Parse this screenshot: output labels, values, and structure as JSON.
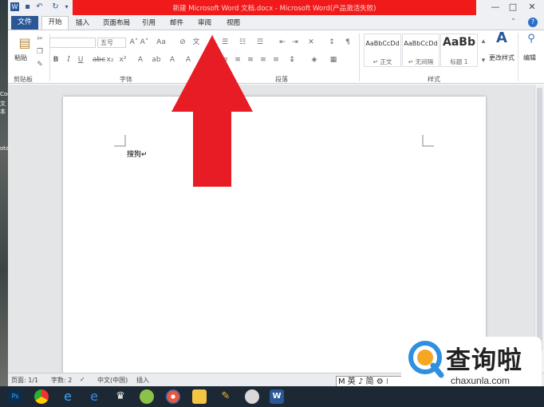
{
  "window": {
    "title": "新建 Microsoft Word 文档.docx - Microsoft Word(产品激活失败)",
    "app_icon": "word-app-icon",
    "controls": [
      "—",
      "□",
      "✕"
    ]
  },
  "desktop": {
    "labels": [
      "Cor",
      "文",
      "本",
      "ota"
    ]
  },
  "tabs": {
    "file": "文件",
    "items": [
      "开始",
      "插入",
      "页面布局",
      "引用",
      "邮件",
      "审阅",
      "视图"
    ]
  },
  "ribbon": {
    "clipboard": {
      "paste": "粘贴",
      "label": "剪贴板"
    },
    "font": {
      "size": "五号",
      "label": "字体"
    },
    "paragraph": {
      "label": "段落"
    },
    "styles": {
      "label": "样式",
      "items": [
        {
          "sample": "AaBbCcDd",
          "name": "↵ 正文"
        },
        {
          "sample": "AaBbCcDd",
          "name": "↵ 无间隔"
        },
        {
          "sample": "AaBb",
          "name": "标题 1"
        }
      ],
      "change": "更改样式"
    },
    "editing": {
      "label": "编辑"
    }
  },
  "document": {
    "text": "搜狗↵"
  },
  "status": {
    "page": "页面: 1/1",
    "words": "字数: 2",
    "lang": "中文(中国)",
    "mode": "插入"
  },
  "ime": {
    "text": "M 英 ♪ 简 ⚙ ⁝"
  },
  "watermark": {
    "brand": "查询啦",
    "url": "chaxunla.com"
  },
  "colors": {
    "accent": "#2b5797",
    "title_red": "#f01a1a",
    "arrow_red": "#e81c24"
  }
}
